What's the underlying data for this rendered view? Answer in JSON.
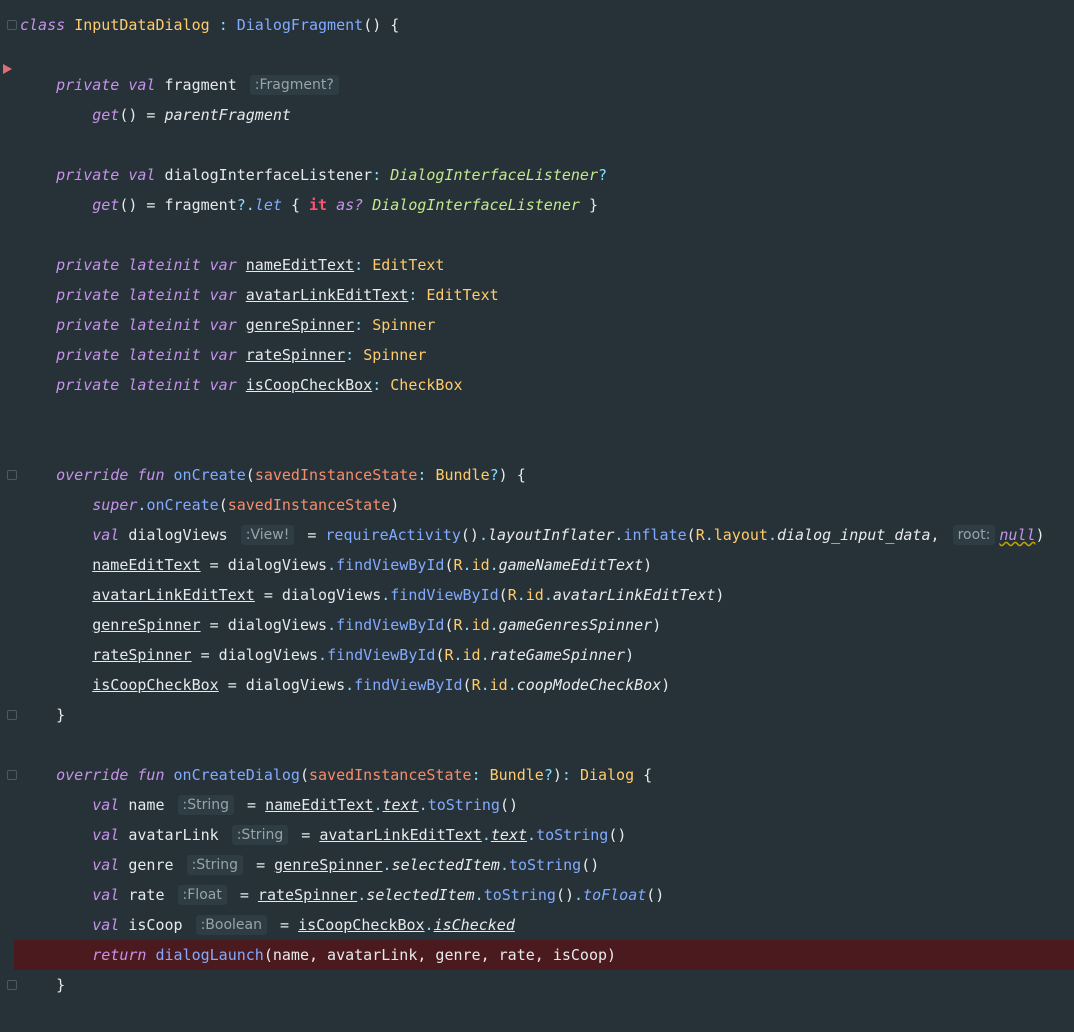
{
  "editor": {
    "theme": {
      "background": "#263238",
      "error_line": "#4A1A1E",
      "breakpoint": "#E06C75"
    },
    "lines": [
      [
        {
          "c": "kw",
          "t": "class "
        },
        {
          "c": "ty",
          "t": "InputDataDialog "
        },
        {
          "c": "punc",
          "t": ": "
        },
        {
          "c": "fn",
          "t": "DialogFragment"
        },
        {
          "c": "plain",
          "t": "() {"
        }
      ],
      [],
      [
        {
          "c": "plain",
          "t": "    "
        },
        {
          "c": "kw",
          "t": "private val "
        },
        {
          "c": "prop",
          "t": "fragment "
        },
        {
          "c": "hint",
          "t": ":Fragment?"
        }
      ],
      [
        {
          "c": "plain",
          "t": "        "
        },
        {
          "c": "kw",
          "t": "get"
        },
        {
          "c": "plain",
          "t": "() = "
        },
        {
          "c": "prop-i",
          "t": "parentFragment"
        }
      ],
      [],
      [
        {
          "c": "plain",
          "t": "    "
        },
        {
          "c": "kw",
          "t": "private val "
        },
        {
          "c": "prop",
          "t": "dialogInterfaceListener"
        },
        {
          "c": "punc",
          "t": ": "
        },
        {
          "c": "typ-it",
          "t": "DialogInterfaceListener"
        },
        {
          "c": "punc",
          "t": "?"
        }
      ],
      [
        {
          "c": "plain",
          "t": "        "
        },
        {
          "c": "kw",
          "t": "get"
        },
        {
          "c": "plain",
          "t": "() = fragment"
        },
        {
          "c": "punc",
          "t": "?."
        },
        {
          "c": "fn-it",
          "t": "let "
        },
        {
          "c": "plain",
          "t": "{ "
        },
        {
          "c": "it-kw",
          "t": "it "
        },
        {
          "c": "kw",
          "t": "as? "
        },
        {
          "c": "typ-it",
          "t": "DialogInterfaceListener "
        },
        {
          "c": "plain",
          "t": "}"
        }
      ],
      [],
      [
        {
          "c": "plain",
          "t": "    "
        },
        {
          "c": "kw",
          "t": "private lateinit var "
        },
        {
          "c": "prop-u",
          "t": "nameEditText"
        },
        {
          "c": "punc",
          "t": ": "
        },
        {
          "c": "ty",
          "t": "EditText"
        }
      ],
      [
        {
          "c": "plain",
          "t": "    "
        },
        {
          "c": "kw",
          "t": "private lateinit var "
        },
        {
          "c": "prop-u",
          "t": "avatarLinkEditText"
        },
        {
          "c": "punc",
          "t": ": "
        },
        {
          "c": "ty",
          "t": "EditText"
        }
      ],
      [
        {
          "c": "plain",
          "t": "    "
        },
        {
          "c": "kw",
          "t": "private lateinit var "
        },
        {
          "c": "prop-u",
          "t": "genreSpinner"
        },
        {
          "c": "punc",
          "t": ": "
        },
        {
          "c": "ty",
          "t": "Spinner"
        }
      ],
      [
        {
          "c": "plain",
          "t": "    "
        },
        {
          "c": "kw",
          "t": "private lateinit var "
        },
        {
          "c": "prop-u",
          "t": "rateSpinner"
        },
        {
          "c": "punc",
          "t": ": "
        },
        {
          "c": "ty",
          "t": "Spinner"
        }
      ],
      [
        {
          "c": "plain",
          "t": "    "
        },
        {
          "c": "kw",
          "t": "private lateinit var "
        },
        {
          "c": "prop-u",
          "t": "isCoopCheckBox"
        },
        {
          "c": "punc",
          "t": ": "
        },
        {
          "c": "ty",
          "t": "CheckBox"
        }
      ],
      [],
      [],
      [
        {
          "c": "plain",
          "t": "    "
        },
        {
          "c": "kw",
          "t": "override fun "
        },
        {
          "c": "fn",
          "t": "onCreate"
        },
        {
          "c": "plain",
          "t": "("
        },
        {
          "c": "param",
          "t": "savedInstanceState"
        },
        {
          "c": "punc",
          "t": ": "
        },
        {
          "c": "ty",
          "t": "Bundle"
        },
        {
          "c": "punc",
          "t": "?"
        },
        {
          "c": "plain",
          "t": ") {"
        }
      ],
      [
        {
          "c": "plain",
          "t": "        "
        },
        {
          "c": "kw",
          "t": "super"
        },
        {
          "c": "punc",
          "t": "."
        },
        {
          "c": "fn",
          "t": "onCreate"
        },
        {
          "c": "plain",
          "t": "("
        },
        {
          "c": "param",
          "t": "savedInstanceState"
        },
        {
          "c": "plain",
          "t": ")"
        }
      ],
      [
        {
          "c": "plain",
          "t": "        "
        },
        {
          "c": "kw",
          "t": "val "
        },
        {
          "c": "prop",
          "t": "dialogViews "
        },
        {
          "c": "hint",
          "t": ":View!"
        },
        {
          "c": "plain",
          "t": " = "
        },
        {
          "c": "fn",
          "t": "requireActivity"
        },
        {
          "c": "plain",
          "t": "()"
        },
        {
          "c": "punc",
          "t": "."
        },
        {
          "c": "prop-i",
          "t": "layoutInflater"
        },
        {
          "c": "punc",
          "t": "."
        },
        {
          "c": "fn",
          "t": "inflate"
        },
        {
          "c": "plain",
          "t": "("
        },
        {
          "c": "rref",
          "t": "R"
        },
        {
          "c": "punc",
          "t": "."
        },
        {
          "c": "rref",
          "t": "layout"
        },
        {
          "c": "punc",
          "t": "."
        },
        {
          "c": "rfield",
          "t": "dialog_input_data"
        },
        {
          "c": "plain",
          "t": ", "
        },
        {
          "c": "hint",
          "t": "root:"
        },
        {
          "c": "kw-null",
          "t": "null"
        },
        {
          "c": "plain",
          "t": ")"
        }
      ],
      [
        {
          "c": "plain",
          "t": "        "
        },
        {
          "c": "prop-u",
          "t": "nameEditText"
        },
        {
          "c": "plain",
          "t": " = dialogViews"
        },
        {
          "c": "punc",
          "t": "."
        },
        {
          "c": "fn",
          "t": "findViewById"
        },
        {
          "c": "plain",
          "t": "("
        },
        {
          "c": "rref",
          "t": "R"
        },
        {
          "c": "punc",
          "t": "."
        },
        {
          "c": "rref",
          "t": "id"
        },
        {
          "c": "punc",
          "t": "."
        },
        {
          "c": "rfield",
          "t": "gameNameEditText"
        },
        {
          "c": "plain",
          "t": ")"
        }
      ],
      [
        {
          "c": "plain",
          "t": "        "
        },
        {
          "c": "prop-u",
          "t": "avatarLinkEditText"
        },
        {
          "c": "plain",
          "t": " = dialogViews"
        },
        {
          "c": "punc",
          "t": "."
        },
        {
          "c": "fn",
          "t": "findViewById"
        },
        {
          "c": "plain",
          "t": "("
        },
        {
          "c": "rref",
          "t": "R"
        },
        {
          "c": "punc",
          "t": "."
        },
        {
          "c": "rref",
          "t": "id"
        },
        {
          "c": "punc",
          "t": "."
        },
        {
          "c": "rfield",
          "t": "avatarLinkEditText"
        },
        {
          "c": "plain",
          "t": ")"
        }
      ],
      [
        {
          "c": "plain",
          "t": "        "
        },
        {
          "c": "prop-u",
          "t": "genreSpinner"
        },
        {
          "c": "plain",
          "t": " = dialogViews"
        },
        {
          "c": "punc",
          "t": "."
        },
        {
          "c": "fn",
          "t": "findViewById"
        },
        {
          "c": "plain",
          "t": "("
        },
        {
          "c": "rref",
          "t": "R"
        },
        {
          "c": "punc",
          "t": "."
        },
        {
          "c": "rref",
          "t": "id"
        },
        {
          "c": "punc",
          "t": "."
        },
        {
          "c": "rfield",
          "t": "gameGenresSpinner"
        },
        {
          "c": "plain",
          "t": ")"
        }
      ],
      [
        {
          "c": "plain",
          "t": "        "
        },
        {
          "c": "prop-u",
          "t": "rateSpinner"
        },
        {
          "c": "plain",
          "t": " = dialogViews"
        },
        {
          "c": "punc",
          "t": "."
        },
        {
          "c": "fn",
          "t": "findViewById"
        },
        {
          "c": "plain",
          "t": "("
        },
        {
          "c": "rref",
          "t": "R"
        },
        {
          "c": "punc",
          "t": "."
        },
        {
          "c": "rref",
          "t": "id"
        },
        {
          "c": "punc",
          "t": "."
        },
        {
          "c": "rfield",
          "t": "rateGameSpinner"
        },
        {
          "c": "plain",
          "t": ")"
        }
      ],
      [
        {
          "c": "plain",
          "t": "        "
        },
        {
          "c": "prop-u",
          "t": "isCoopCheckBox"
        },
        {
          "c": "plain",
          "t": " = dialogViews"
        },
        {
          "c": "punc",
          "t": "."
        },
        {
          "c": "fn",
          "t": "findViewById"
        },
        {
          "c": "plain",
          "t": "("
        },
        {
          "c": "rref",
          "t": "R"
        },
        {
          "c": "punc",
          "t": "."
        },
        {
          "c": "rref",
          "t": "id"
        },
        {
          "c": "punc",
          "t": "."
        },
        {
          "c": "rfield",
          "t": "coopModeCheckBox"
        },
        {
          "c": "plain",
          "t": ")"
        }
      ],
      [
        {
          "c": "plain",
          "t": "    }"
        }
      ],
      [],
      [
        {
          "c": "plain",
          "t": "    "
        },
        {
          "c": "kw",
          "t": "override fun "
        },
        {
          "c": "fn",
          "t": "onCreateDialog"
        },
        {
          "c": "plain",
          "t": "("
        },
        {
          "c": "param",
          "t": "savedInstanceState"
        },
        {
          "c": "punc",
          "t": ": "
        },
        {
          "c": "ty",
          "t": "Bundle"
        },
        {
          "c": "punc",
          "t": "?"
        },
        {
          "c": "plain",
          "t": ")"
        },
        {
          "c": "punc",
          "t": ": "
        },
        {
          "c": "ty",
          "t": "Dialog "
        },
        {
          "c": "plain",
          "t": "{"
        }
      ],
      [
        {
          "c": "plain",
          "t": "        "
        },
        {
          "c": "kw",
          "t": "val "
        },
        {
          "c": "prop",
          "t": "name "
        },
        {
          "c": "hint",
          "t": ":String"
        },
        {
          "c": "plain",
          "t": " = "
        },
        {
          "c": "prop-u",
          "t": "nameEditText"
        },
        {
          "c": "punc",
          "t": "."
        },
        {
          "c": "prop-iu",
          "t": "text"
        },
        {
          "c": "punc",
          "t": "."
        },
        {
          "c": "fn",
          "t": "toString"
        },
        {
          "c": "plain",
          "t": "()"
        }
      ],
      [
        {
          "c": "plain",
          "t": "        "
        },
        {
          "c": "kw",
          "t": "val "
        },
        {
          "c": "prop",
          "t": "avatarLink "
        },
        {
          "c": "hint",
          "t": ":String"
        },
        {
          "c": "plain",
          "t": " = "
        },
        {
          "c": "prop-u",
          "t": "avatarLinkEditText"
        },
        {
          "c": "punc",
          "t": "."
        },
        {
          "c": "prop-iu",
          "t": "text"
        },
        {
          "c": "punc",
          "t": "."
        },
        {
          "c": "fn",
          "t": "toString"
        },
        {
          "c": "plain",
          "t": "()"
        }
      ],
      [
        {
          "c": "plain",
          "t": "        "
        },
        {
          "c": "kw",
          "t": "val "
        },
        {
          "c": "prop",
          "t": "genre "
        },
        {
          "c": "hint",
          "t": ":String"
        },
        {
          "c": "plain",
          "t": " = "
        },
        {
          "c": "prop-u",
          "t": "genreSpinner"
        },
        {
          "c": "punc",
          "t": "."
        },
        {
          "c": "prop-i",
          "t": "selectedItem"
        },
        {
          "c": "punc",
          "t": "."
        },
        {
          "c": "fn",
          "t": "toString"
        },
        {
          "c": "plain",
          "t": "()"
        }
      ],
      [
        {
          "c": "plain",
          "t": "        "
        },
        {
          "c": "kw",
          "t": "val "
        },
        {
          "c": "prop",
          "t": "rate "
        },
        {
          "c": "hint",
          "t": ":Float"
        },
        {
          "c": "plain",
          "t": " = "
        },
        {
          "c": "prop-u",
          "t": "rateSpinner"
        },
        {
          "c": "punc",
          "t": "."
        },
        {
          "c": "prop-i",
          "t": "selectedItem"
        },
        {
          "c": "punc",
          "t": "."
        },
        {
          "c": "fn",
          "t": "toString"
        },
        {
          "c": "plain",
          "t": "()"
        },
        {
          "c": "punc",
          "t": "."
        },
        {
          "c": "fn-it",
          "t": "toFloat"
        },
        {
          "c": "plain",
          "t": "()"
        }
      ],
      [
        {
          "c": "plain",
          "t": "        "
        },
        {
          "c": "kw",
          "t": "val "
        },
        {
          "c": "prop",
          "t": "isCoop "
        },
        {
          "c": "hint",
          "t": ":Boolean"
        },
        {
          "c": "plain",
          "t": " = "
        },
        {
          "c": "prop-u",
          "t": "isCoopCheckBox"
        },
        {
          "c": "punc",
          "t": "."
        },
        {
          "c": "prop-iu",
          "t": "isChecked"
        }
      ],
      [
        {
          "c": "plain",
          "t": "        "
        },
        {
          "c": "kw",
          "t": "return "
        },
        {
          "c": "fn",
          "t": "dialogLaunch"
        },
        {
          "c": "plain",
          "t": "(name, avatarLink, genre, rate, isCoop)"
        }
      ],
      [
        {
          "c": "plain",
          "t": "    }"
        }
      ]
    ],
    "error_line_index": 31
  }
}
